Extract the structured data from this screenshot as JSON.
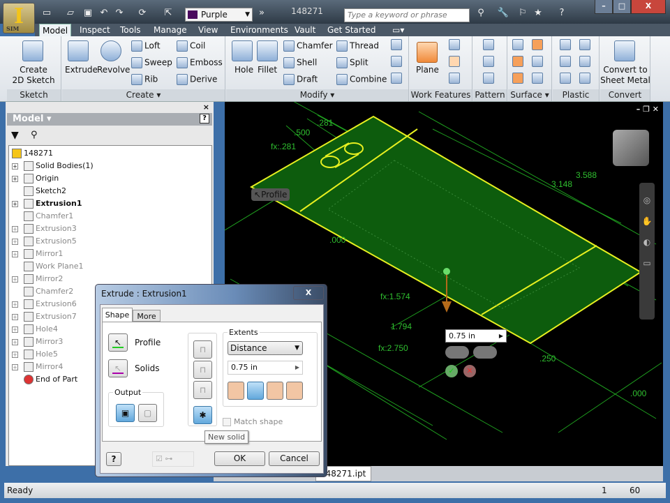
{
  "app": {
    "document_title": "148271",
    "app_badge": "SIM",
    "color_override": "Purple",
    "color_swatch": "#4a0a5e",
    "search_placeholder": "Type a keyword or phrase"
  },
  "ribbon_tabs": [
    "Model",
    "Inspect",
    "Tools",
    "Manage",
    "View",
    "Environments",
    "Vault",
    "Get Started"
  ],
  "ribbon": {
    "sketch": {
      "label": "Sketch",
      "create_sketch": "Create\n2D Sketch",
      "create_sketch_l1": "Create",
      "create_sketch_l2": "2D Sketch"
    },
    "create": {
      "label": "Create ▾",
      "extrude": "Extrude",
      "revolve": "Revolve",
      "loft": "Loft",
      "sweep": "Sweep",
      "rib": "Rib",
      "coil": "Coil",
      "emboss": "Emboss",
      "derive": "Derive"
    },
    "modify": {
      "label": "Modify ▾",
      "hole": "Hole",
      "fillet": "Fillet",
      "chamfer": "Chamfer",
      "shell": "Shell",
      "draft": "Draft",
      "thread": "Thread",
      "split": "Split",
      "combine": "Combine"
    },
    "work_features": {
      "label": "Work Features",
      "plane": "Plane"
    },
    "pattern": {
      "label": "Pattern"
    },
    "surface": {
      "label": "Surface ▾"
    },
    "plastic_part": {
      "label": "Plastic Part"
    },
    "convert": {
      "label": "Convert",
      "convert_l1": "Convert to",
      "convert_l2": "Sheet Metal"
    }
  },
  "browser": {
    "title": "Model ▾",
    "items": [
      {
        "label": "148271",
        "expand": false,
        "state": "root"
      },
      {
        "label": "Solid Bodies(1)",
        "expand": true,
        "state": "normal"
      },
      {
        "label": "Origin",
        "expand": true,
        "state": "normal"
      },
      {
        "label": "Sketch2",
        "expand": false,
        "state": "normal"
      },
      {
        "label": "Extrusion1",
        "expand": true,
        "state": "bold"
      },
      {
        "label": "Chamfer1",
        "expand": false,
        "state": "dim"
      },
      {
        "label": "Extrusion3",
        "expand": true,
        "state": "dim"
      },
      {
        "label": "Extrusion5",
        "expand": true,
        "state": "dim"
      },
      {
        "label": "Mirror1",
        "expand": true,
        "state": "dim"
      },
      {
        "label": "Work Plane1",
        "expand": false,
        "state": "dim"
      },
      {
        "label": "Mirror2",
        "expand": true,
        "state": "dim"
      },
      {
        "label": "Chamfer2",
        "expand": false,
        "state": "dim"
      },
      {
        "label": "Extrusion6",
        "expand": true,
        "state": "dim"
      },
      {
        "label": "Extrusion7",
        "expand": true,
        "state": "dim"
      },
      {
        "label": "Hole4",
        "expand": true,
        "state": "dim"
      },
      {
        "label": "Mirror3",
        "expand": true,
        "state": "dim"
      },
      {
        "label": "Hole5",
        "expand": true,
        "state": "dim"
      },
      {
        "label": "Mirror4",
        "expand": true,
        "state": "dim"
      },
      {
        "label": "End of Part",
        "expand": false,
        "state": "end"
      }
    ]
  },
  "viewport": {
    "profile_tag": "Profile",
    "dimensions": {
      "d1": "3.588",
      "d2": "3.148",
      "d3": ".500",
      "d4": ".281",
      "d5": "fx:.281",
      "d6": ".000",
      "d7": "fx:1.574",
      "d8": "1.794",
      "d9": "fx:2.750",
      "d10": ".250",
      "d11": ".000"
    },
    "mini_distance": "0.75 in"
  },
  "dialog": {
    "title": "Extrude : Extrusion1",
    "tabs": [
      "Shape",
      "More"
    ],
    "profile": "Profile",
    "solids": "Solids",
    "output": "Output",
    "extents": "Extents",
    "extents_type": "Distance",
    "distance": "0.75 in",
    "match_shape": "Match shape",
    "tooltip": "New solid",
    "ok": "OK",
    "cancel": "Cancel",
    "help": "?"
  },
  "doc_tabs": [
    "148271.ipt"
  ],
  "status": {
    "text": "Ready",
    "count1": "1",
    "count2": "60"
  }
}
